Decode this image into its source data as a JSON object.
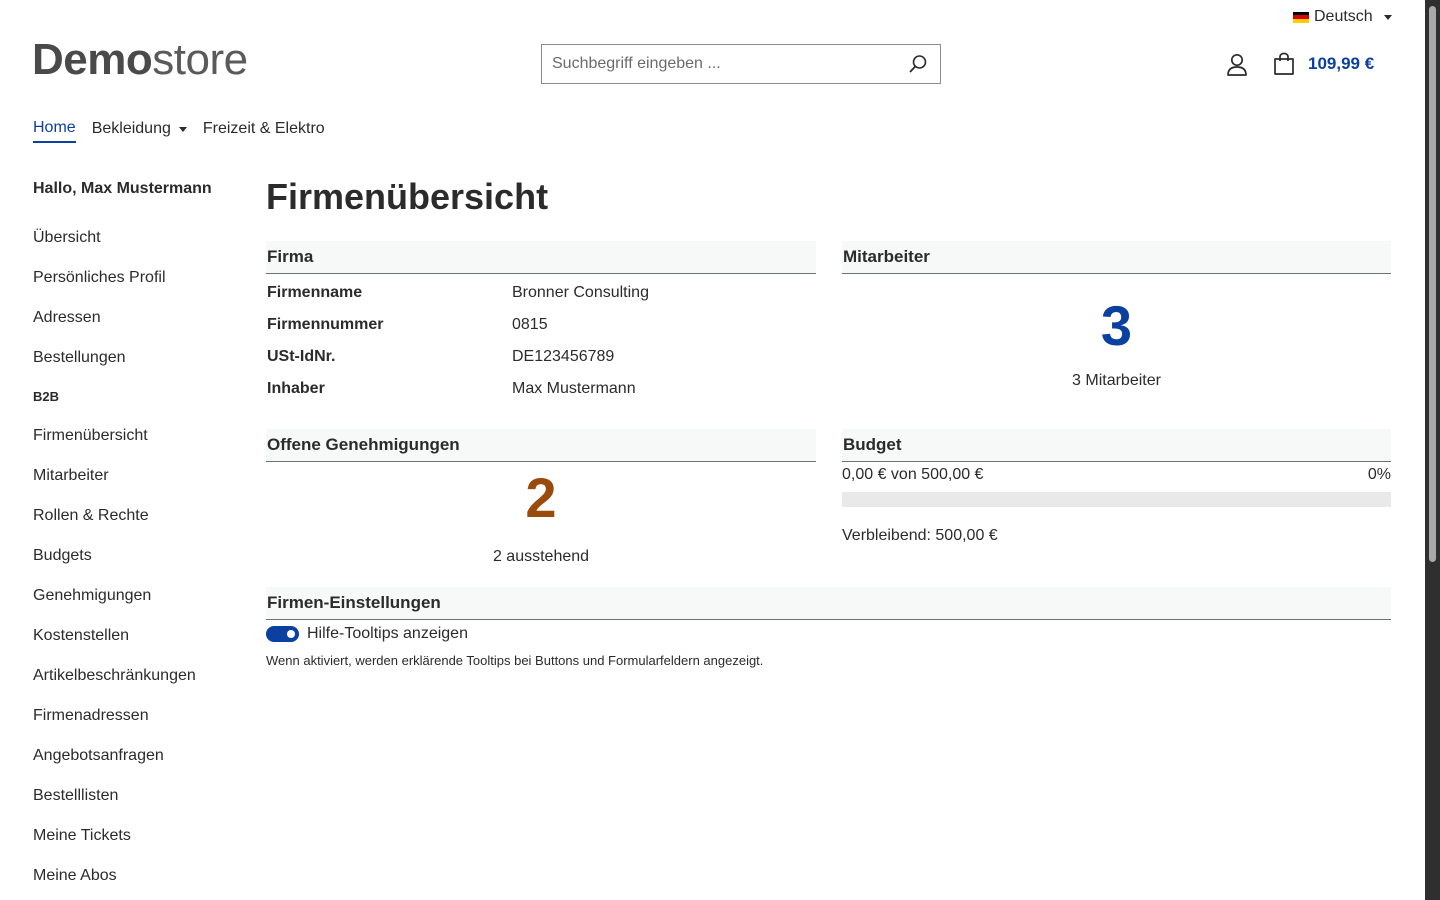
{
  "header": {
    "language": "Deutsch",
    "logo_bold": "Demo",
    "logo_light": "store",
    "search_placeholder": "Suchbegriff eingeben ...",
    "cart_total": "109,99 €"
  },
  "colors": {
    "accent": "#0b3fa0",
    "warning": "#9a4a0a"
  },
  "nav": {
    "items": [
      {
        "label": "Home",
        "active": true,
        "dropdown": false
      },
      {
        "label": "Bekleidung",
        "active": false,
        "dropdown": true
      },
      {
        "label": "Freizeit & Elektro",
        "active": false,
        "dropdown": false
      }
    ]
  },
  "sidebar": {
    "greeting": "Hallo, Max Mustermann",
    "items": [
      "Übersicht",
      "Persönliches Profil",
      "Adressen",
      "Bestellungen"
    ],
    "section_label": "B2B",
    "b2b_items": [
      "Firmenübersicht",
      "Mitarbeiter",
      "Rollen & Rechte",
      "Budgets",
      "Genehmigungen",
      "Kostenstellen",
      "Artikelbeschränkungen",
      "Firmenadressen",
      "Angebotsanfragen",
      "Bestelllisten",
      "Meine Tickets",
      "Meine Abos"
    ]
  },
  "main": {
    "title": "Firmenübersicht",
    "firma": {
      "heading": "Firma",
      "rows": [
        {
          "label": "Firmenname",
          "value": "Bronner Consulting"
        },
        {
          "label": "Firmennummer",
          "value": "0815"
        },
        {
          "label": "USt-IdNr.",
          "value": "DE123456789"
        },
        {
          "label": "Inhaber",
          "value": "Max Mustermann"
        }
      ]
    },
    "mitarbeiter": {
      "heading": "Mitarbeiter",
      "count": "3",
      "caption": "3 Mitarbeiter"
    },
    "offene": {
      "heading": "Offene Genehmigungen",
      "count": "2",
      "caption": "2 ausstehend"
    },
    "budget": {
      "heading": "Budget",
      "used_text": "0,00 € von 500,00 €",
      "percent_text": "0%",
      "progress": 0,
      "remaining": "Verbleibend: 500,00 €"
    },
    "settings": {
      "heading": "Firmen-Einstellungen",
      "toggle_label": "Hilfe-Tooltips anzeigen",
      "toggle_on": true,
      "hint": "Wenn aktiviert, werden erklärende Tooltips bei Buttons und Formularfeldern angezeigt."
    }
  }
}
